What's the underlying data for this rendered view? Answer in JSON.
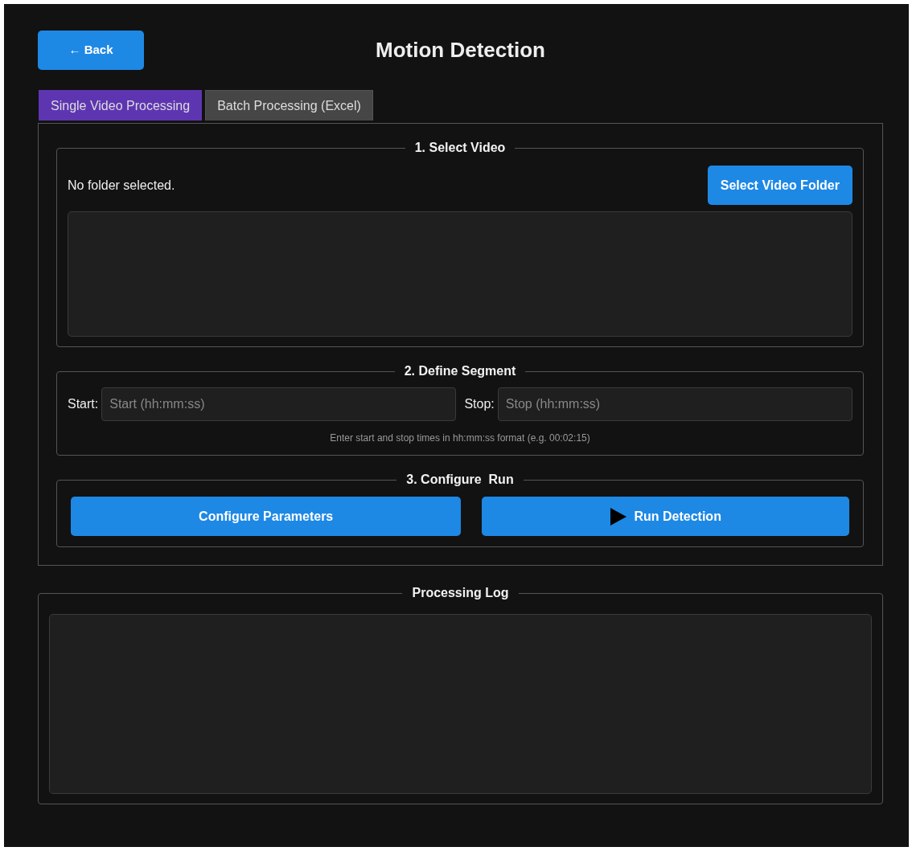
{
  "header": {
    "back_button": "← Back",
    "title": "Motion Detection"
  },
  "tabs": [
    {
      "label": "Single Video Processing",
      "selected": true
    },
    {
      "label": "Batch Processing (Excel)",
      "selected": false
    }
  ],
  "select_video": {
    "title": "1. Select Video",
    "status": "No folder selected.",
    "button": "Select Video Folder"
  },
  "define_segment": {
    "title": "2. Define Segment",
    "start_label": "Start:",
    "start_placeholder": "Start (hh:mm:ss)",
    "stop_label": "Stop:",
    "stop_placeholder": "Stop (hh:mm:ss)",
    "hint": "Enter start and stop times in hh:mm:ss format (e.g. 00:02:15)"
  },
  "configure_run": {
    "title": "3. Configure  Run",
    "buttons": [
      {
        "label": "Configure Parameters",
        "kind": "text"
      },
      {
        "label": "Run Detection",
        "kind": "play"
      }
    ]
  },
  "processing_log": {
    "title": "Processing Log"
  }
}
